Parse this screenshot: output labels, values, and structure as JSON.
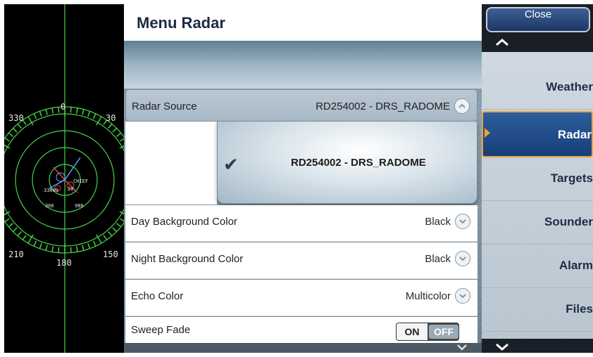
{
  "radar_display": {
    "bearing_labels": [
      "330",
      "0",
      "30",
      "210",
      "180",
      "150"
    ],
    "target_labels": [
      "CHIEF",
      "33009",
      "20",
      "366",
      "980"
    ]
  },
  "menu": {
    "title": "Menu Radar",
    "rows": {
      "radar_source": {
        "label": "Radar Source",
        "value": "RD254002 - DRS_RADOME"
      },
      "dropdown_option": {
        "label": "RD254002 - DRS_RADOME",
        "selected": true
      },
      "day_background": {
        "label": "Day Background Color",
        "value": "Black"
      },
      "night_background": {
        "label": "Night Background Color",
        "value": "Black"
      },
      "echo_color": {
        "label": "Echo Color",
        "value": "Multicolor"
      },
      "sweep_fade": {
        "label": "Sweep Fade",
        "on_label": "ON",
        "off_label": "OFF",
        "state": "OFF"
      }
    },
    "icons": {
      "expand": "chevron-up-icon",
      "collapse": "chevron-down-icon",
      "check": "checkmark-icon"
    }
  },
  "nav": {
    "close_label": "Close",
    "items": [
      {
        "label": "Weather",
        "active": false
      },
      {
        "label": "Radar",
        "active": true
      },
      {
        "label": "Targets",
        "active": false
      },
      {
        "label": "Sounder",
        "active": false
      },
      {
        "label": "Alarm",
        "active": false
      },
      {
        "label": "Files",
        "active": false
      }
    ]
  },
  "colors": {
    "radar_green": "#47d34a",
    "nav_active": "#1f4a86",
    "nav_active_border": "#e8a33c",
    "title_text": "#1b2a44"
  }
}
